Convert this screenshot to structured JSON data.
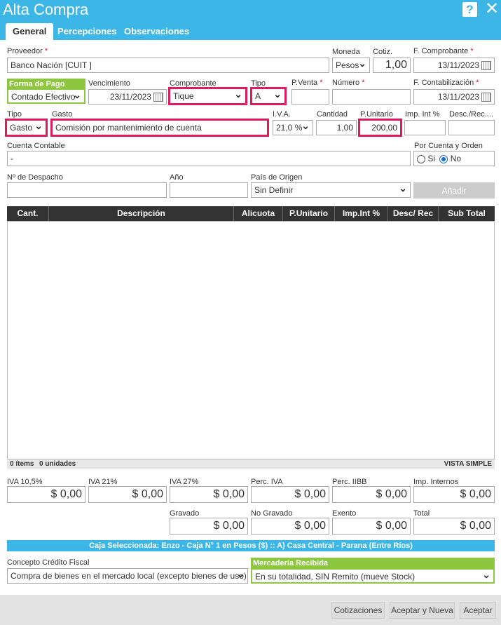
{
  "window": {
    "title": "Alta Compra",
    "help_label": "?",
    "close_label": "✕"
  },
  "tabs": [
    "General",
    "Percepciones",
    "Observaciones"
  ],
  "fields": {
    "proveedor_label": "Proveedor",
    "proveedor_value": "Banco Nación [CUIT ]",
    "moneda_label": "Moneda",
    "moneda_value": "Pesos",
    "cotiz_label": "Cotiz.",
    "cotiz_value": "1,00",
    "f_comprobante_label": "F. Comprobante",
    "f_comprobante_value": "13/11/2023",
    "forma_pago_label": "Forma de Pago",
    "forma_pago_value": "Contado Efectivo",
    "vencimiento_label": "Vencimiento",
    "vencimiento_value": "23/11/2023",
    "comprobante_label": "Comprobante",
    "comprobante_value": "Tique",
    "tipo_label": "Tipo",
    "tipo_value": "A",
    "pventa_label": "P.Venta",
    "pventa_value": "",
    "numero_label": "Número",
    "numero_value": "",
    "f_contab_label": "F. Contabilización",
    "f_contab_value": "13/11/2023",
    "tipo2_label": "Tipo",
    "tipo2_value": "Gasto",
    "gasto_label": "Gasto",
    "gasto_value": "Comisión por mantenimiento de cuenta",
    "iva_label": "I.V.A.",
    "iva_value": "21,0 %",
    "cantidad_label": "Cantidad",
    "cantidad_value": "1,00",
    "punitario_label": "P.Unitario",
    "punitario_value": "200,00",
    "impint_label": "Imp. Int %",
    "impint_value": "",
    "descrec_label": "Desc./Rec....",
    "descrec_value": "",
    "cuenta_label": "Cuenta Contable",
    "cuenta_value": "-",
    "porcuenta_label": "Por Cuenta y Orden",
    "si_label": "Si",
    "no_label": "No",
    "despacho_label": "Nº de Despacho",
    "anio_label": "Año",
    "pais_label": "País de Origen",
    "pais_value": "Sin Definir",
    "anadir_label": "Añadir"
  },
  "grid": {
    "columns": [
      "Cant.",
      "Descripción",
      "Alicuota",
      "P.Unitario",
      "Imp.Int %",
      "Desc/ Rec",
      "Sub Total"
    ],
    "footer_items": "0 ítems",
    "footer_units": "0 unidades",
    "footer_view": "VISTA SIMPLE"
  },
  "totals": [
    {
      "label": "IVA 10,5%",
      "value": "$ 0,00"
    },
    {
      "label": "IVA 21%",
      "value": "$ 0,00"
    },
    {
      "label": "IVA 27%",
      "value": "$ 0,00"
    },
    {
      "label": "Perc. IVA",
      "value": "$ 0,00"
    },
    {
      "label": "Perc. IIBB",
      "value": "$ 0,00"
    },
    {
      "label": "Imp. Internos",
      "value": "$ 0,00"
    },
    {
      "label": "Gravado",
      "value": "$ 0,00"
    },
    {
      "label": "No Gravado",
      "value": "$ 0,00"
    },
    {
      "label": "Exento",
      "value": "$ 0,00"
    },
    {
      "label": "Total",
      "value": "$ 0,00"
    }
  ],
  "caja_text": "Caja Seleccionada: Enzo - Caja N° 1 en Pesos ($) :: A) Casa Central - Parana (Entre Ríos)",
  "concepto_label": "Concepto Crédito Fiscal",
  "concepto_value": "Compra de bienes en el mercado local (excepto bienes de uso)",
  "mercaderia_label": "Mercadería Recibida",
  "mercaderia_value": "En su totalidad, SIN Remito (mueve Stock)",
  "buttons": {
    "cotizaciones": "Cotizaciones",
    "aceptar_nueva": "Aceptar y Nueva",
    "aceptar": "Aceptar"
  },
  "colors": {
    "accent": "#3bb6e6",
    "highlight": "#e01a5c",
    "green": "#8dc63f",
    "required": "#d0143c"
  }
}
